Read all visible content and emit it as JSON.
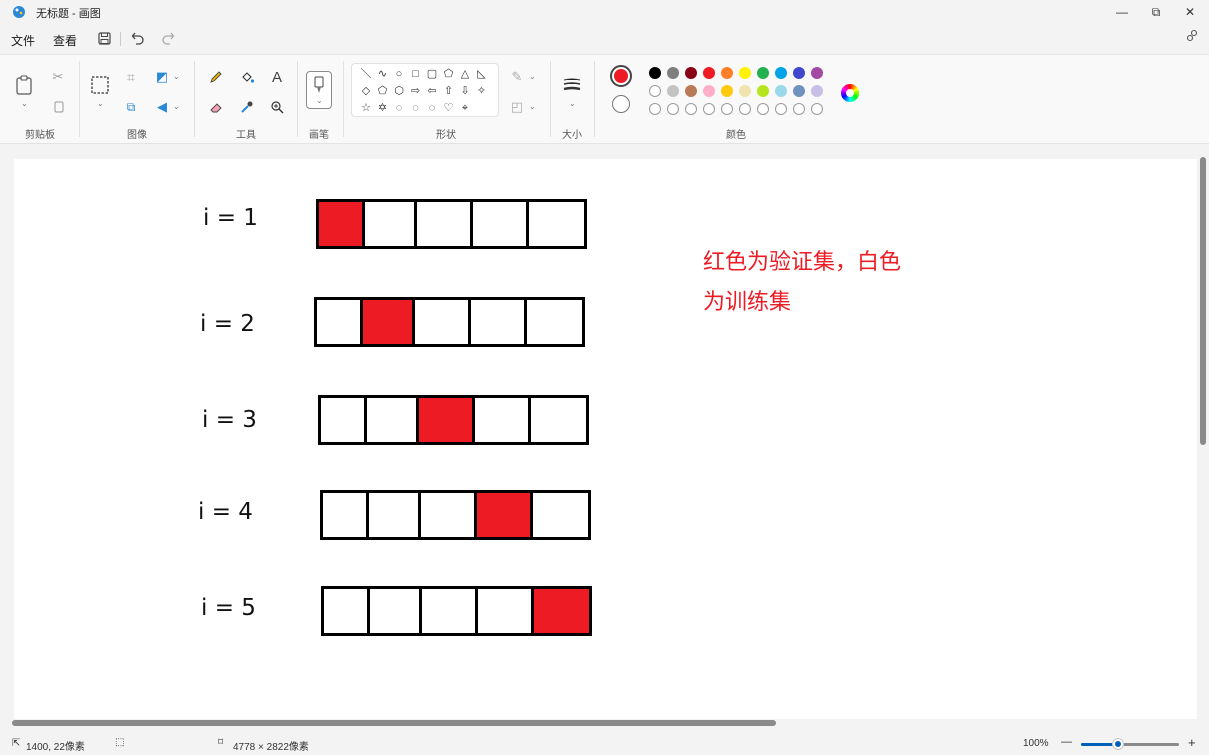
{
  "window": {
    "title": "无标题 - 画图",
    "controls": {
      "minimize": "—",
      "maximize": "⧉",
      "close": "✕"
    }
  },
  "menu": {
    "file": "文件",
    "view": "查看",
    "quick_access_icons": [
      "save-icon",
      "undo-icon",
      "redo-icon"
    ]
  },
  "ribbon": {
    "groups": {
      "clipboard": "剪贴板",
      "image": "图像",
      "tools": "工具",
      "brushes": "画笔",
      "shapes": "形状",
      "size": "大小",
      "colors": "颜色"
    },
    "tools_icons": [
      "pencil-icon",
      "fill-icon",
      "text-icon",
      "eraser-icon",
      "color-picker-icon",
      "magnifier-icon"
    ],
    "shapes": [
      "＼",
      "∿",
      "○",
      "□",
      "▢",
      "⬠",
      "△",
      "◺",
      "◇",
      "⬠",
      "⬡",
      "⇨",
      "⇦",
      "⇧",
      "⇩",
      "✧",
      "☆",
      "✡",
      "💬",
      "💬",
      "💬",
      "♡",
      "⌖"
    ]
  },
  "colors": {
    "color1": "#ed1c24",
    "color2": "#ffffff",
    "palette_row1": [
      "#000000",
      "#7f7f7f",
      "#880015",
      "#ed1c24",
      "#ff7f27",
      "#fff200",
      "#22b14c",
      "#00a2e8",
      "#3f48cc",
      "#a349a4"
    ],
    "palette_row2": [
      "#ffffff",
      "#c3c3c3",
      "#b97a57",
      "#ffaec9",
      "#ffc90e",
      "#efe4b0",
      "#b5e61d",
      "#99d9ea",
      "#7092be",
      "#c8bfe7"
    ],
    "custom_slots": 10
  },
  "canvas": {
    "rows": [
      {
        "label": "i = 1",
        "cells": [
          "red",
          "white",
          "white",
          "white",
          "white"
        ]
      },
      {
        "label": "i = 2",
        "cells": [
          "white",
          "red",
          "white",
          "white",
          "white"
        ]
      },
      {
        "label": "i = 3",
        "cells": [
          "white",
          "white",
          "red",
          "white",
          "white"
        ]
      },
      {
        "label": "i = 4",
        "cells": [
          "white",
          "white",
          "white",
          "red",
          "white"
        ]
      },
      {
        "label": "i = 5",
        "cells": [
          "white",
          "white",
          "white",
          "white",
          "red"
        ]
      }
    ],
    "note": "红色为验证集，白色\n为训练集"
  },
  "status": {
    "cursor_position": "1400, 22像素",
    "canvas_size": "4778 × 2822像素",
    "zoom": "100%",
    "zoom_minus": "—",
    "zoom_plus": "+"
  }
}
